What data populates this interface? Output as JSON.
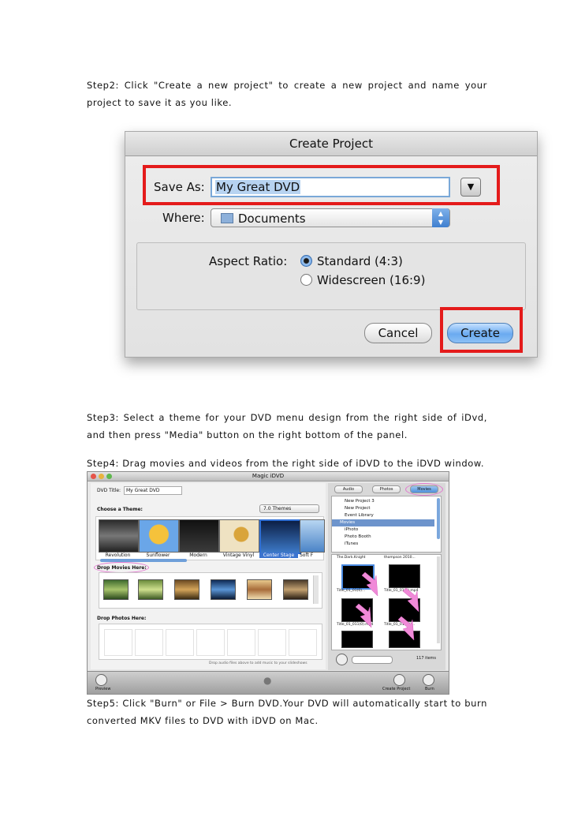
{
  "step2": {
    "text": "Step2: Click \"Create a new project\" to create a new project and name your project to save it as you like."
  },
  "create_project": {
    "title": "Create Project",
    "save_as_label": "Save As:",
    "save_as_value": "My Great DVD",
    "where_label": "Where:",
    "where_value": "Documents",
    "aspect_label": "Aspect Ratio:",
    "aspect_options": [
      "Standard (4:3)",
      "Widescreen (16:9)"
    ],
    "aspect_selected": "Standard (4:3)",
    "cancel_label": "Cancel",
    "create_label": "Create",
    "highlight_color": "#e41b1b"
  },
  "step3": {
    "text": "Step3: Select a theme for your DVD menu design from the right side of iDvd, and then press \"Media\" button on the right bottom of the panel."
  },
  "step4": {
    "text": "Step4: Drag movies and videos from the right side of iDVD to the iDVD window."
  },
  "idvd": {
    "window_title": "Magic iDVD",
    "dvd_title_label": "DVD Title:",
    "dvd_title_value": "My Great DVD",
    "choose_theme_label": "Choose a Theme:",
    "theme_version": "7.0 Themes",
    "themes": [
      "Revolution",
      "Sunflower",
      "Modern",
      "Vintage Vinyl",
      "Center Stage",
      "Soft F"
    ],
    "drop_movies_label": "Drop Movies Here:",
    "drop_photos_label": "Drop Photos Here:",
    "drop_audio_hint": "Drop audio files above to add music to your slideshows",
    "tabs": [
      "Audio",
      "Photos",
      "Movies"
    ],
    "sources": [
      "New Project 3",
      "New Project",
      "Event Library",
      "Movies",
      "iPhoto",
      "Photo Booth",
      "iTunes"
    ],
    "movie_headers": [
      "The.Dark.Knight",
      "thompson 2010..."
    ],
    "movie_items": [
      "Title_01_01(0)...",
      "Title_01_01(0).mp4",
      "Title_01_011(0).mp4",
      "Title_01_012(0)..."
    ],
    "item_count": "117 items",
    "preview_label": "Preview",
    "create_project_label": "Create Project",
    "burn_label": "Burn",
    "annotation_color": "#e27ad0"
  },
  "step5": {
    "text": "Step5: Click \"Burn\" or File > Burn DVD.Your DVD will automatically start to burn converted MKV files to DVD with iDVD on Mac."
  }
}
